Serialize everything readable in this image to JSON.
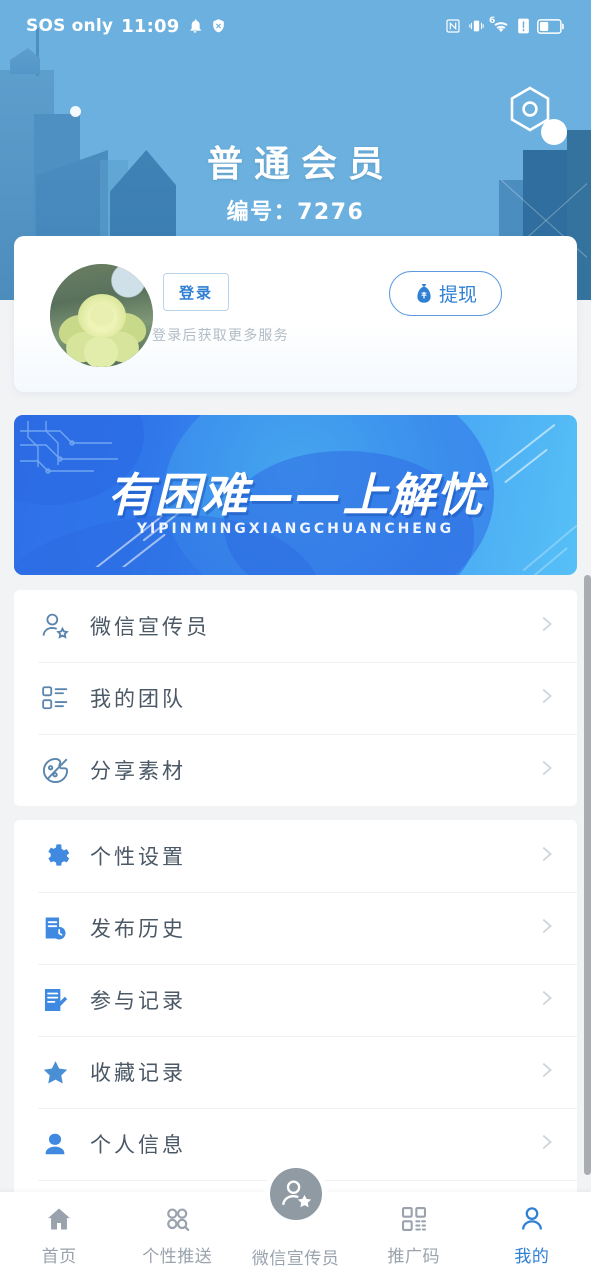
{
  "statusbar": {
    "carrier": "SOS only",
    "time": "11:09",
    "left_icons": [
      "bell-icon",
      "shield-off-icon"
    ],
    "right_icons": [
      "nfc-icon",
      "vibrate-icon",
      "wifi-6-icon",
      "sim-alert-icon",
      "battery-icon"
    ],
    "wifi_label": "6"
  },
  "header": {
    "title": "普通会员",
    "subtitle": "编号：7276",
    "settings_icon": "hex-gear-icon",
    "bg_color": "#6bb0de"
  },
  "profile": {
    "avatar_name": "avatar",
    "login_label": "登录",
    "login_hint": "登录后获取更多服务",
    "withdraw_label": "提现",
    "withdraw_icon": "money-bag-icon",
    "accent_color": "#2f7fd4"
  },
  "banner": {
    "title": "有困难——上解忧",
    "pinyin": "YIPINMINGXIANGCHUANCHENG"
  },
  "menu": {
    "groups": [
      {
        "items": [
          {
            "label": "微信宣传员",
            "icon": "person-star-outline-icon",
            "style": "outline"
          },
          {
            "label": "我的团队",
            "icon": "team-list-outline-icon",
            "style": "outline"
          },
          {
            "label": "分享素材",
            "icon": "share-material-outline-icon",
            "style": "outline"
          }
        ]
      },
      {
        "items": [
          {
            "label": "个性设置",
            "icon": "gear-icon",
            "style": "solid"
          },
          {
            "label": "发布历史",
            "icon": "document-clock-icon",
            "style": "solid"
          },
          {
            "label": "参与记录",
            "icon": "document-pen-icon",
            "style": "solid"
          },
          {
            "label": "收藏记录",
            "icon": "star-icon",
            "style": "solid"
          },
          {
            "label": "个人信息",
            "icon": "person-icon",
            "style": "solid"
          }
        ]
      }
    ]
  },
  "tabbar": {
    "items": [
      {
        "label": "首页",
        "icon": "home-icon",
        "active": false
      },
      {
        "label": "个性推送",
        "icon": "circles-icon",
        "active": false
      },
      {
        "label": "微信宣传员",
        "icon": "person-star-icon",
        "active": false,
        "center": true
      },
      {
        "label": "推广码",
        "icon": "qr-code-icon",
        "active": false
      },
      {
        "label": "我的",
        "icon": "person-outline-icon",
        "active": true
      }
    ],
    "active_color": "#2f7fd4",
    "inactive_color": "#9aa3ad"
  }
}
